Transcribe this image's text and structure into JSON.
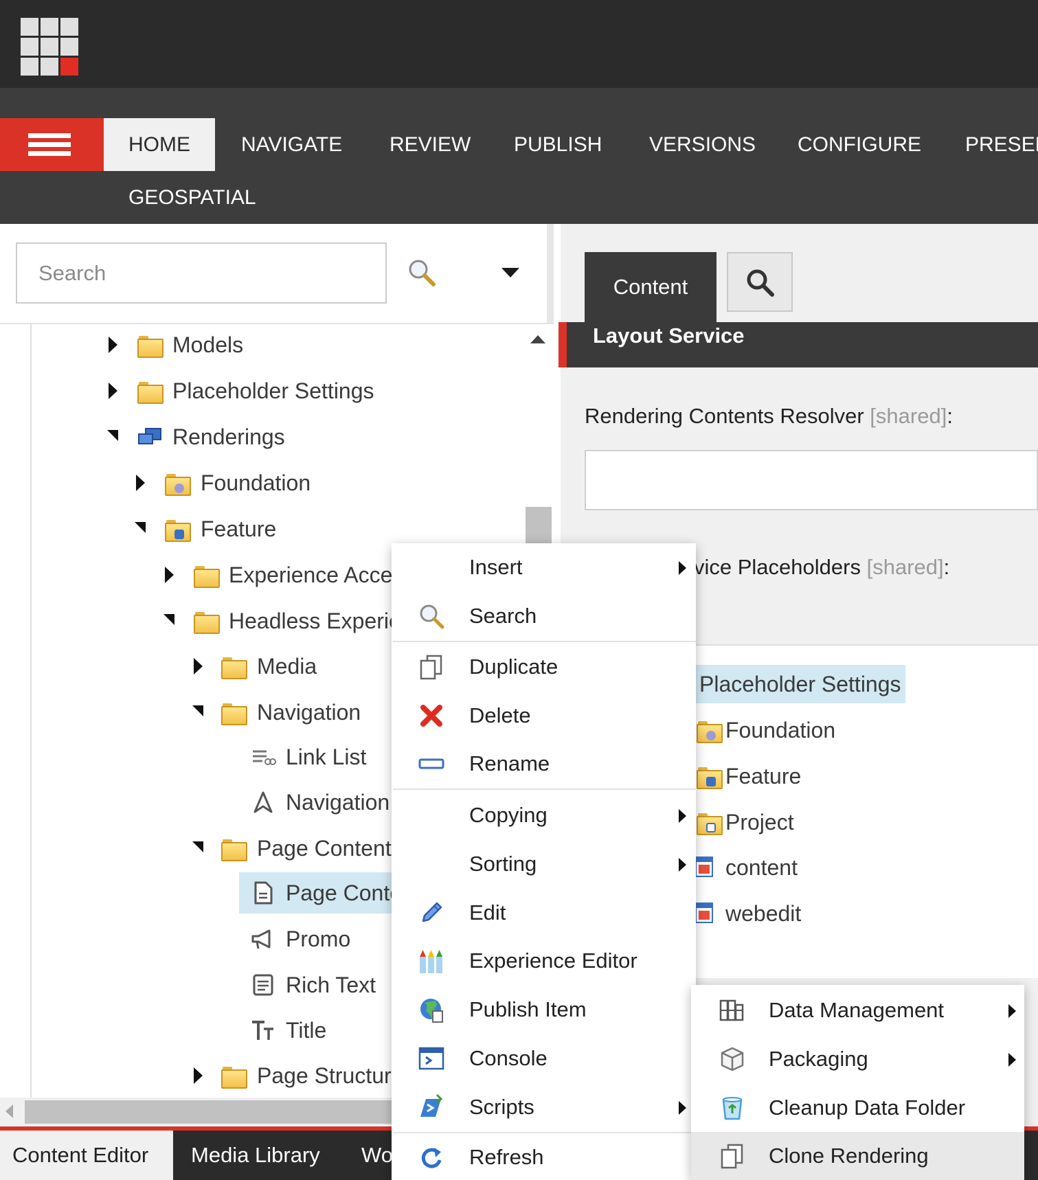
{
  "ribbon": {
    "tabs": [
      "HOME",
      "NAVIGATE",
      "REVIEW",
      "PUBLISH",
      "VERSIONS",
      "CONFIGURE",
      "PRESEN"
    ],
    "second_row": [
      "GEOSPATIAL"
    ],
    "active": "HOME"
  },
  "tree_search": {
    "placeholder": "Search"
  },
  "tree": [
    {
      "label": "Models",
      "icon": "folder-icon",
      "state": "collapsed"
    },
    {
      "label": "Placeholder Settings",
      "icon": "folder-icon",
      "state": "collapsed"
    },
    {
      "label": "Renderings",
      "icon": "renderings-icon",
      "state": "expanded"
    },
    {
      "label": "Foundation",
      "icon": "folder-gear-icon",
      "state": "collapsed"
    },
    {
      "label": "Feature",
      "icon": "folder-feature-icon",
      "state": "expanded"
    },
    {
      "label": "Experience Accel",
      "icon": "folder-icon",
      "state": "collapsed"
    },
    {
      "label": "Headless Experie",
      "icon": "folder-icon",
      "state": "expanded"
    },
    {
      "label": "Media",
      "icon": "folder-icon",
      "state": "collapsed"
    },
    {
      "label": "Navigation",
      "icon": "folder-icon",
      "state": "expanded"
    },
    {
      "label": "Link List",
      "icon": "link-list-icon",
      "state": "leaf"
    },
    {
      "label": "Navigation",
      "icon": "navigation-icon",
      "state": "leaf"
    },
    {
      "label": "Page Content",
      "icon": "folder-icon",
      "state": "expanded"
    },
    {
      "label": "Page Conte",
      "icon": "document-icon",
      "state": "leaf",
      "selected": true
    },
    {
      "label": "Promo",
      "icon": "megaphone-icon",
      "state": "leaf"
    },
    {
      "label": "Rich Text",
      "icon": "rich-text-icon",
      "state": "leaf"
    },
    {
      "label": "Title",
      "icon": "title-icon",
      "state": "leaf"
    },
    {
      "label": "Page Structure",
      "icon": "folder-icon",
      "state": "collapsed"
    }
  ],
  "editor": {
    "tab_content": "Content",
    "section_title": "Layout Service",
    "field1_label": "Rendering Contents Resolver",
    "field2_label": "vice Placeholders",
    "shared_tag": "[shared]",
    "colon": ":",
    "treelist": [
      {
        "label": "Placeholder Settings",
        "icon": "folder-icon",
        "selected": true
      },
      {
        "label": "Foundation",
        "icon": "folder-gear-icon"
      },
      {
        "label": "Feature",
        "icon": "folder-feature-icon"
      },
      {
        "label": "Project",
        "icon": "folder-project-icon"
      },
      {
        "label": "content",
        "icon": "calendar-icon"
      },
      {
        "label": "webedit",
        "icon": "calendar-icon"
      }
    ]
  },
  "context_menu": [
    {
      "label": "Insert",
      "submenu": true
    },
    {
      "label": "Search",
      "icon": "search-icon"
    },
    {
      "label": "Duplicate",
      "icon": "duplicate-icon"
    },
    {
      "label": "Delete",
      "icon": "delete-icon"
    },
    {
      "label": "Rename",
      "icon": "rename-icon"
    },
    {
      "label": "Copying",
      "submenu": true
    },
    {
      "label": "Sorting",
      "submenu": true
    },
    {
      "label": "Edit",
      "icon": "pencil-icon"
    },
    {
      "label": "Experience Editor",
      "icon": "crayons-icon"
    },
    {
      "label": "Publish Item",
      "icon": "globe-icon"
    },
    {
      "label": "Console",
      "icon": "console-icon"
    },
    {
      "label": "Scripts",
      "icon": "scripts-icon",
      "submenu": true
    },
    {
      "label": "Refresh",
      "icon": "refresh-icon"
    }
  ],
  "scripts_submenu": [
    {
      "label": "Data Management",
      "icon": "data-management-icon",
      "submenu": true
    },
    {
      "label": "Packaging",
      "icon": "package-icon",
      "submenu": true
    },
    {
      "label": "Cleanup Data Folder",
      "icon": "recycle-bin-icon"
    },
    {
      "label": "Clone Rendering",
      "icon": "clone-icon",
      "hover": true
    }
  ],
  "bottom_tabs": [
    "Content Editor",
    "Media Library",
    "Wo"
  ],
  "colors": {
    "accent": "#db3228",
    "dark": "#2b2b2b",
    "ribbon": "#3d3d3d",
    "selection": "#d2e8f2"
  }
}
